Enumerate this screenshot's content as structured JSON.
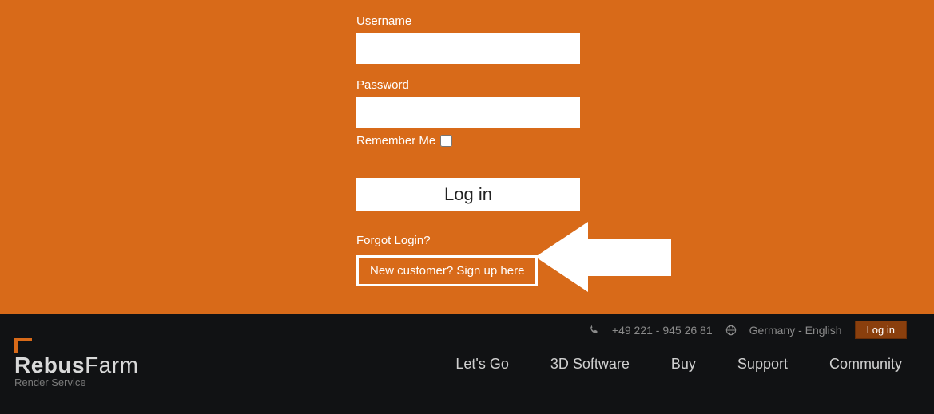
{
  "login": {
    "username_label": "Username",
    "password_label": "Password",
    "remember_label": "Remember Me",
    "login_button": "Log in",
    "forgot_link": "Forgot Login?",
    "signup_button": "New customer? Sign up here"
  },
  "topbar": {
    "phone": "+49 221 - 945 26 81",
    "language": "Germany - English",
    "login_button": "Log in"
  },
  "logo": {
    "name_part1": "Rebus",
    "name_part2": "Farm",
    "subtitle": "Render Service"
  },
  "nav": {
    "items": [
      "Let's Go",
      "3D Software",
      "Buy",
      "Support",
      "Community"
    ]
  }
}
